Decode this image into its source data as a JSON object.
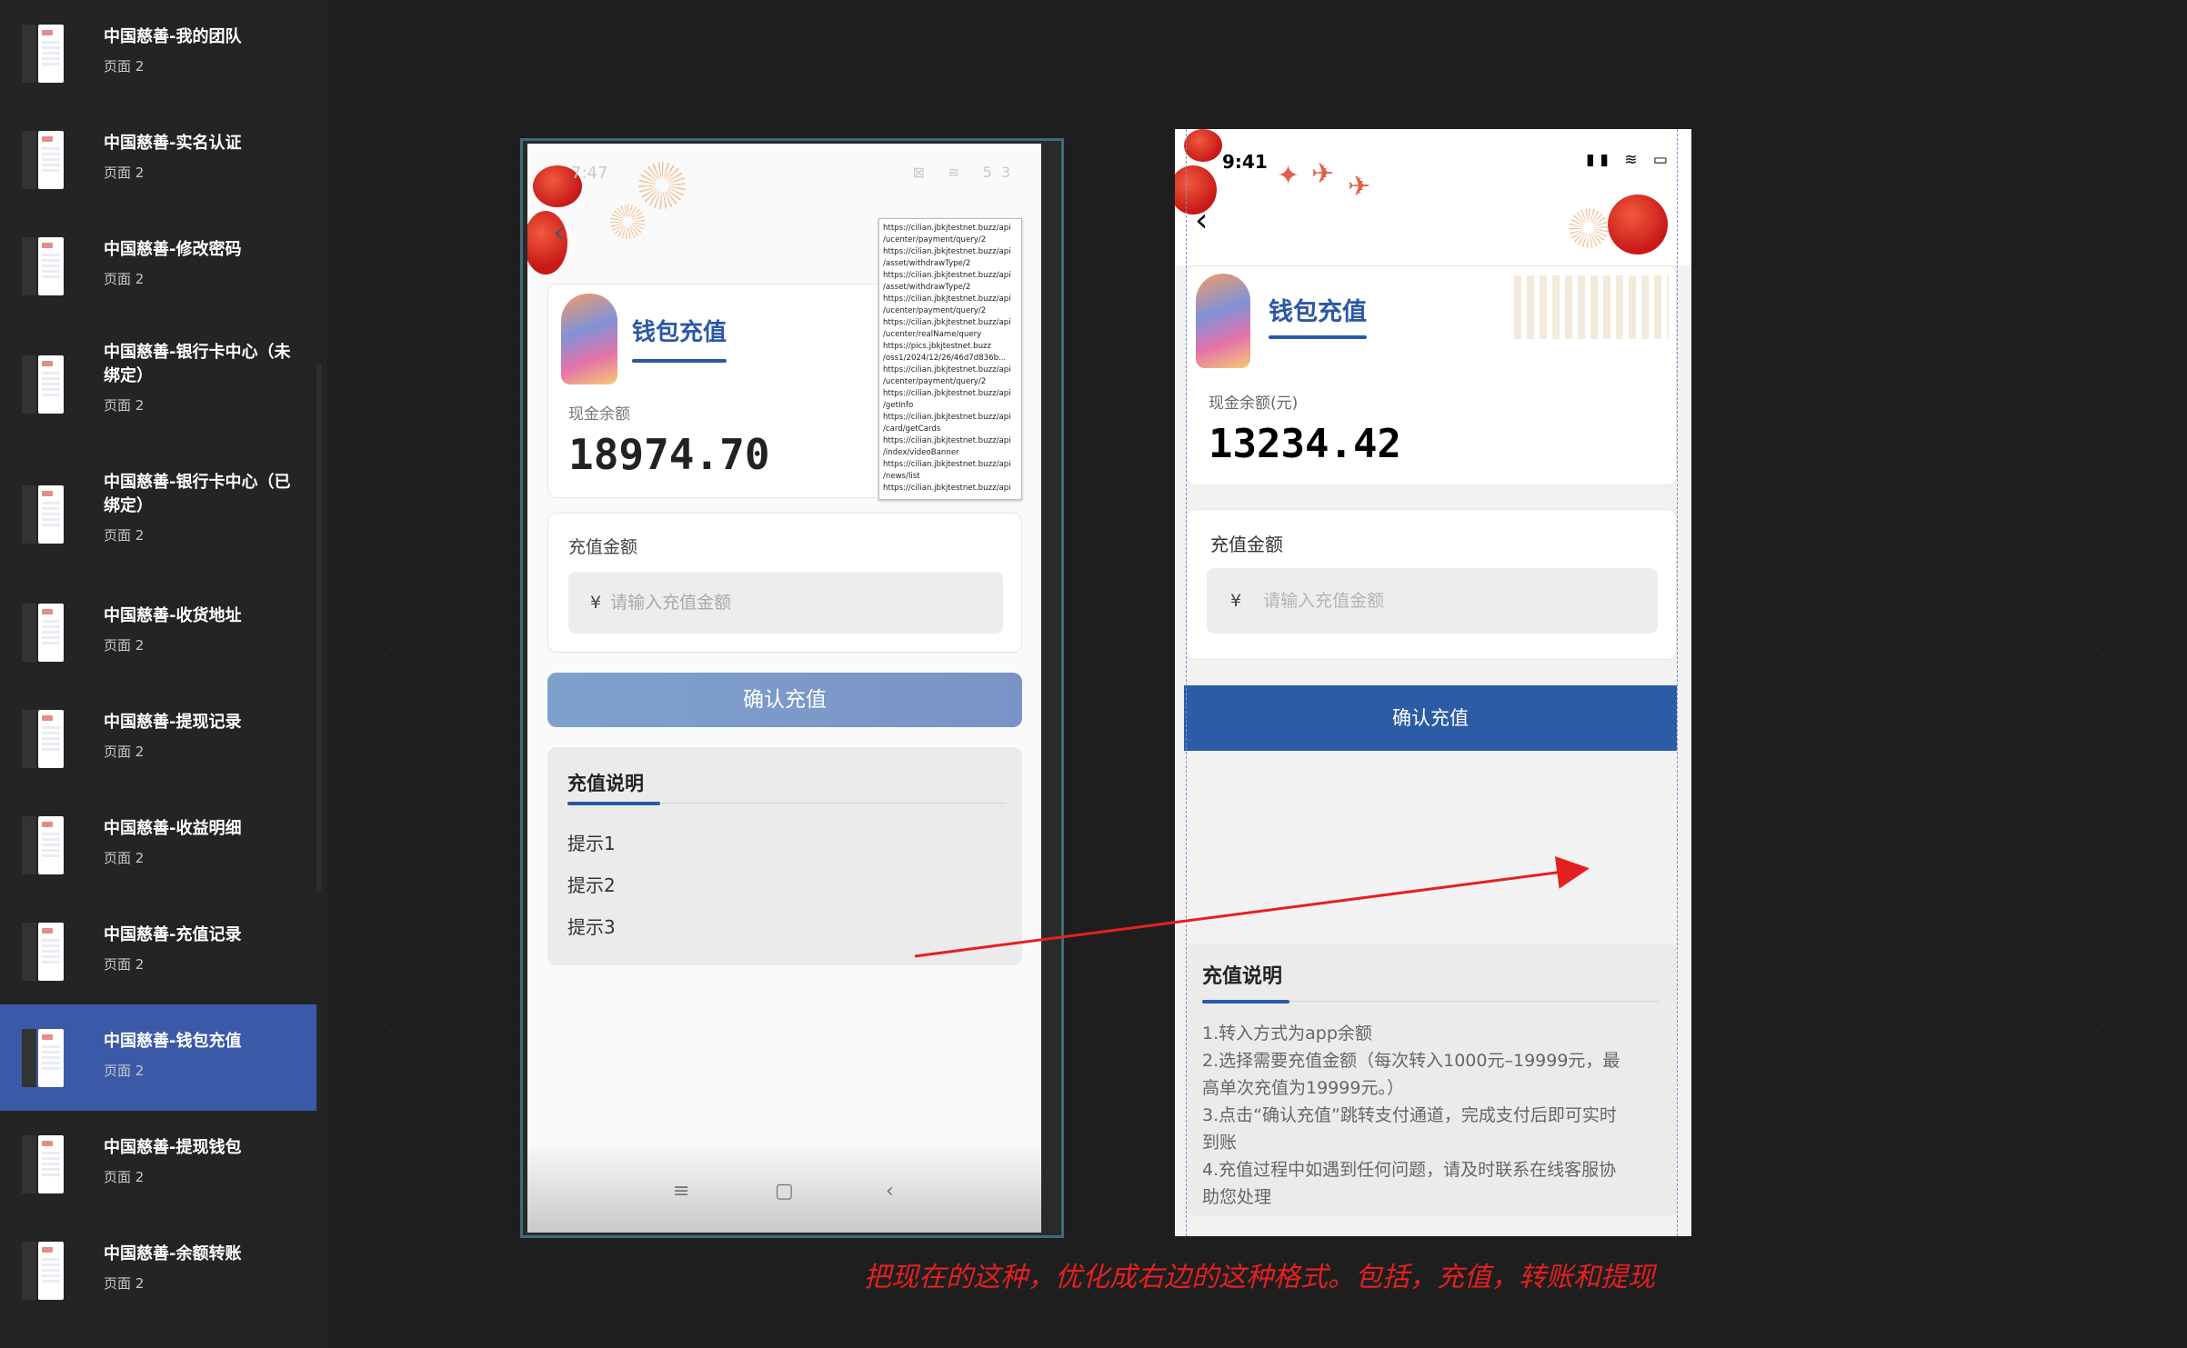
{
  "sidebar": {
    "items": [
      {
        "title": "中国慈善-我的团队",
        "sub": "页面 2",
        "active": false
      },
      {
        "title": "中国慈善-实名认证",
        "sub": "页面 2",
        "active": false
      },
      {
        "title": "中国慈善-修改密码",
        "sub": "页面 2",
        "active": false
      },
      {
        "title": "中国慈善-银行卡中心（未绑定）",
        "sub": "页面 2",
        "active": false
      },
      {
        "title": "中国慈善-银行卡中心（已绑定）",
        "sub": "页面 2",
        "active": false
      },
      {
        "title": "中国慈善-收货地址",
        "sub": "页面 2",
        "active": false
      },
      {
        "title": "中国慈善-提现记录",
        "sub": "页面 2",
        "active": false
      },
      {
        "title": "中国慈善-收益明细",
        "sub": "页面 2",
        "active": false
      },
      {
        "title": "中国慈善-充值记录",
        "sub": "页面 2",
        "active": false
      },
      {
        "title": "中国慈善-钱包充值",
        "sub": "页面 2",
        "active": true
      },
      {
        "title": "中国慈善-提现钱包",
        "sub": "页面 2",
        "active": false
      },
      {
        "title": "中国慈善-余额转账",
        "sub": "页面 2",
        "active": false
      }
    ]
  },
  "old_phone": {
    "status_time": "7:47",
    "status_battery": "53",
    "card_title": "钱包充值",
    "balance_label": "现金余额",
    "balance_value": "18974.70",
    "amount_label": "充值金额",
    "currency_symbol": "¥",
    "amount_placeholder": "请输入充值金额",
    "confirm_label": "确认充值",
    "notes_title": "充值说明",
    "tips": [
      "提示1",
      "提示2",
      "提示3"
    ],
    "url_lines": [
      "https://cilian.jbkjtestnet.buzz/api",
      "/ucenter/payment/query/2",
      "https://cilian.jbkjtestnet.buzz/api",
      "/asset/withdrawType/2",
      "https://cilian.jbkjtestnet.buzz/api",
      "/asset/withdrawType/2",
      "https://cilian.jbkjtestnet.buzz/api",
      "/ucenter/payment/query/2",
      "https://cilian.jbkjtestnet.buzz/api",
      "/ucenter/realName/query",
      "https://pics.jbkjtestnet.buzz",
      "/oss1/2024/12/26/46d7d836b...",
      "https://cilian.jbkjtestnet.buzz/api",
      "/ucenter/payment/query/2",
      "https://cilian.jbkjtestnet.buzz/api",
      "/getInfo",
      "https://cilian.jbkjtestnet.buzz/api",
      "/card/getCards",
      "https://cilian.jbkjtestnet.buzz/api",
      "/index/videoBanner",
      "https://cilian.jbkjtestnet.buzz/api",
      "/news/list",
      "https://cilian.jbkjtestnet.buzz/api"
    ],
    "nav_icons": [
      "≡",
      "▢",
      "‹"
    ]
  },
  "new_phone": {
    "status_time": "9:41",
    "card_title": "钱包充值",
    "balance_label": "现金余额(元)",
    "balance_value": "13234.42",
    "amount_label": "充值金额",
    "currency_symbol": "¥",
    "amount_placeholder": "请输入充值金额",
    "confirm_label": "确认充值",
    "notes_title": "充值说明",
    "notes": [
      "1.转入方式为app余额",
      "2.选择需要充值金额（每次转入1000元–19999元，最",
      "高单次充值为19999元。）",
      "3.点击“确认充值”跳转支付通道，完成支付后即可实时",
      "到账",
      "4.充值过程中如遇到任何问题，请及时联系在线客服协",
      "助您处理"
    ]
  },
  "annotation": {
    "caption": "把现在的这种，优化成右边的这种格式。包括，充值，转账和提现",
    "color": "#e52020"
  },
  "colors": {
    "brand_blue": "#2c57a4",
    "sidebar_active": "#3a5aa8"
  }
}
